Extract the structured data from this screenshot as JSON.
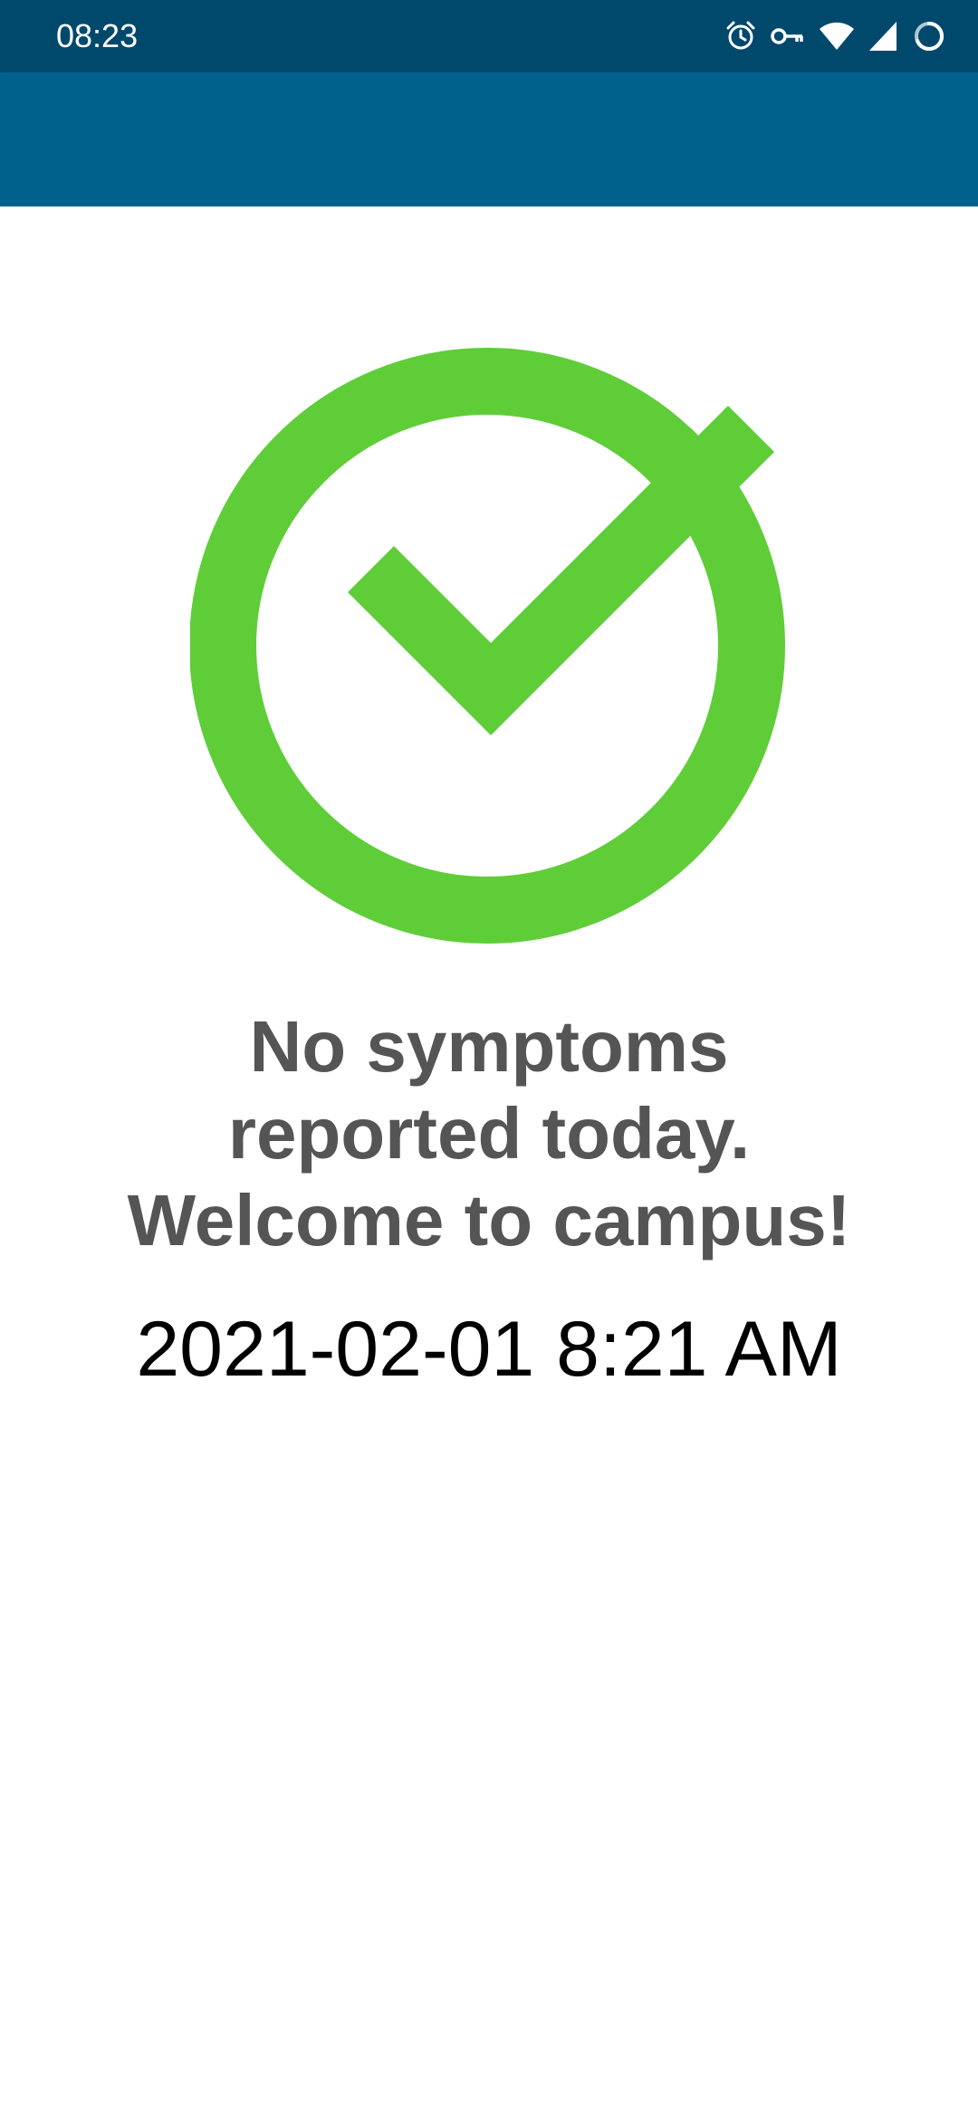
{
  "status_bar": {
    "time": "08:23",
    "icons": [
      "alarm-icon",
      "vpn-key-icon",
      "wifi-icon",
      "cellular-signal-icon",
      "sync-progress-icon"
    ]
  },
  "main": {
    "status_icon": "check-circle-icon",
    "message_lines": [
      "No symptoms",
      "reported today.",
      "Welcome to campus!"
    ],
    "timestamp": "2021-02-01 8:21 AM"
  },
  "colors": {
    "status_bar_bg": "#00496d",
    "app_bar_bg": "#00628c",
    "check_green": "#5fcd38",
    "message_text": "#555555"
  }
}
